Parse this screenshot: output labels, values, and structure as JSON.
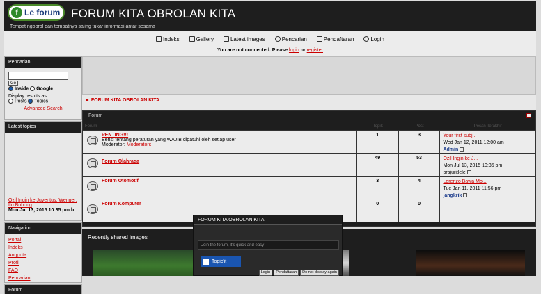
{
  "header": {
    "logo": "Le forum",
    "title": "FORUM KITA OBROLAN KITA",
    "description": "Tempat ngobrol dan tempatnya saling tukar informasi antar sesama"
  },
  "nav": [
    {
      "label": "Indeks",
      "icon": "home-icon"
    },
    {
      "label": "Gallery",
      "icon": "gallery-icon"
    },
    {
      "label": "Latest images",
      "icon": "images-icon"
    },
    {
      "label": "Pencarian",
      "icon": "search-icon"
    },
    {
      "label": "Pendaftaran",
      "icon": "register-icon"
    },
    {
      "label": "Login",
      "icon": "login-icon"
    }
  ],
  "notice": {
    "prefix": "You are not connected.  Please",
    "login": "login",
    "or": "or",
    "register": "register"
  },
  "search": {
    "title": "Pencarian",
    "button": "Go",
    "inside": "Inside",
    "google": "Google",
    "display_label": "Display results as :",
    "posts": "Posts",
    "topics": "Topics",
    "advanced": "Advanced Search"
  },
  "latest": {
    "title": "Latest topics",
    "topic": "Ozil Ingin ke Juventus, Wenger: Itu Bohong",
    "date": "Mon Jul 13, 2015 10:35 pm b"
  },
  "navigation": {
    "title": "Navigation",
    "items": [
      "Portal",
      "Indeks",
      "Anggota",
      "Profil",
      "FAQ",
      "Pencarian"
    ]
  },
  "forum_box": {
    "title": "Forum"
  },
  "breadcrumb": "FORUM KITA OBROLAN KITA",
  "table": {
    "title": "Forum",
    "cols": [
      "Forum",
      "Topik",
      "Post",
      "Pesan Terakhir"
    ],
    "rows": [
      {
        "name": "PENTING!!!",
        "desc": "Berisi tentang peraturan yang WAJIB dipatuhi oleh setiap user",
        "mod_label": "Moderator:",
        "mod": "Moderators",
        "topics": "1",
        "posts": "3",
        "last_title": "Your first subj...",
        "last_date": "Wed Jan 12, 2011 12:00 am",
        "last_user": "Admin"
      },
      {
        "name": "Forum Olahraga",
        "desc": "",
        "mod_label": "",
        "mod": "",
        "topics": "49",
        "posts": "53",
        "last_title": "Ozil Ingin ke J...",
        "last_date": "Mon Jul 13, 2015 10:35 pm",
        "last_user": "prajuritlele"
      },
      {
        "name": "Forum Otomotif",
        "desc": "",
        "mod_label": "",
        "mod": "",
        "topics": "3",
        "posts": "4",
        "last_title": "Lorenzo Bawa Mo...",
        "last_date": "Tue Jan 11, 2011 11:56 pm",
        "last_user": "jangkrik"
      },
      {
        "name": "Forum Komputer",
        "desc": "",
        "mod_label": "",
        "mod": "",
        "topics": "0",
        "posts": "0",
        "last_title": "",
        "last_date": "",
        "last_user": ""
      }
    ]
  },
  "gallery": {
    "title": "Recently shared images"
  },
  "popup": {
    "title": "FORUM KITA OBROLAN KITA",
    "join": "Join the forum, it's quick and easy",
    "topicit": "Topic'it",
    "buttons": [
      "Login",
      "Pendaftaran",
      "Do not display again"
    ]
  },
  "colors": {
    "header_bg": "#1e1e1e",
    "link": "#cc0000",
    "topicit": "#1a55b0"
  }
}
